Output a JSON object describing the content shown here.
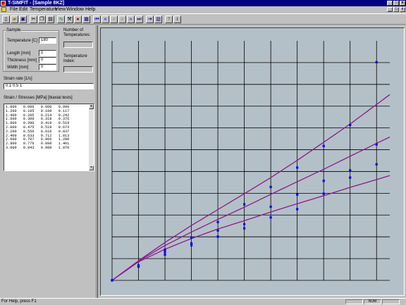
{
  "window": {
    "title": "T-SIMFIT - [Sample 8KZ]"
  },
  "menu": {
    "items": [
      "File",
      "Edit",
      "Temperature",
      "View",
      "Window",
      "Help"
    ]
  },
  "toolbar": {
    "icons": [
      "new-file-icon",
      "open-folder-icon",
      "save-icon",
      "cut-icon",
      "copy-icon",
      "paste-icon",
      "curve-icon",
      "tool-icon",
      "stop-icon",
      "chart-icon",
      "nav-first-icon",
      "nav-prev-fast-icon",
      "nav-prev-icon",
      "nav-next-icon",
      "nav-next-fast-icon",
      "nav-last-icon",
      "export-icon",
      "table-icon",
      "help-icon",
      "info-icon"
    ]
  },
  "sample": {
    "group_label": "Sample",
    "temperature_label": "Temperature [C]",
    "temperature_value": "180",
    "length_label": "Length [mm]",
    "length_value": "1",
    "thickness_label": "Thickness [mm]",
    "thickness_value": "0",
    "width_label": "Width [mm]",
    "width_value": "0",
    "num_temps_label": "Number of Temperatures:",
    "temp_index_label": "Temperature Index:"
  },
  "strain_rate": {
    "label": "Strain rate [1/s]",
    "value": "0.1  0.5  1"
  },
  "stresses": {
    "label": "Strain / Stresses [MPa] [biaxial tests]",
    "rows": [
      "1.000   0.000   0.000   0.000",
      "1.200   0.105   0.109   0.117",
      "1.400   0.205   0.214   0.242",
      "1.600   0.300   0.318   0.376",
      "1.800   0.390   0.419   0.519",
      "2.000   0.475   0.519   0.673",
      "2.200   0.556   0.616   0.837",
      "2.400   0.633   0.712   1.013",
      "2.600   0.707   0.806   1.200",
      "2.800   0.776   0.898   1.401",
      "3.000   0.843   0.988   1.970"
    ]
  },
  "status": {
    "help_text": "For Help, press F1",
    "num": "NUM"
  },
  "colors": {
    "plot_bg": "#b4c0c8",
    "grid": "#000000",
    "curve": "#8a1a8a",
    "marker": "#0000ff"
  },
  "chart_data": {
    "type": "scatter",
    "title": "",
    "xlabel": "",
    "ylabel": "",
    "xlim": [
      1.0,
      3.1
    ],
    "ylim": [
      0.0,
      1.1
    ],
    "grid": true,
    "x": [
      1.0,
      1.2,
      1.4,
      1.6,
      1.8,
      2.0,
      2.2,
      2.4,
      2.6,
      2.8,
      3.0
    ],
    "series": [
      {
        "values": [
          0.0,
          0.063,
          0.118,
          0.161,
          0.201,
          0.239,
          0.289,
          0.327,
          0.398,
          0.472,
          0.533
        ]
      },
      {
        "values": [
          0.0,
          0.069,
          0.13,
          0.17,
          0.229,
          0.258,
          0.338,
          0.394,
          0.457,
          0.505,
          0.624
        ]
      },
      {
        "values": [
          0.0,
          0.063,
          0.141,
          0.196,
          0.268,
          0.349,
          0.429,
          0.518,
          0.617,
          0.714,
          1.002
        ]
      }
    ],
    "fitted_curves": [
      {
        "values": [
          0.0,
          0.085,
          0.143,
          0.192,
          0.236,
          0.274,
          0.314,
          0.352,
          0.389,
          0.427,
          0.463
        ]
      },
      {
        "values": [
          0.0,
          0.088,
          0.16,
          0.222,
          0.28,
          0.336,
          0.395,
          0.453,
          0.51,
          0.57,
          0.629
        ]
      },
      {
        "values": [
          0.0,
          0.09,
          0.174,
          0.252,
          0.325,
          0.398,
          0.472,
          0.551,
          0.634,
          0.718,
          0.808
        ]
      }
    ]
  }
}
